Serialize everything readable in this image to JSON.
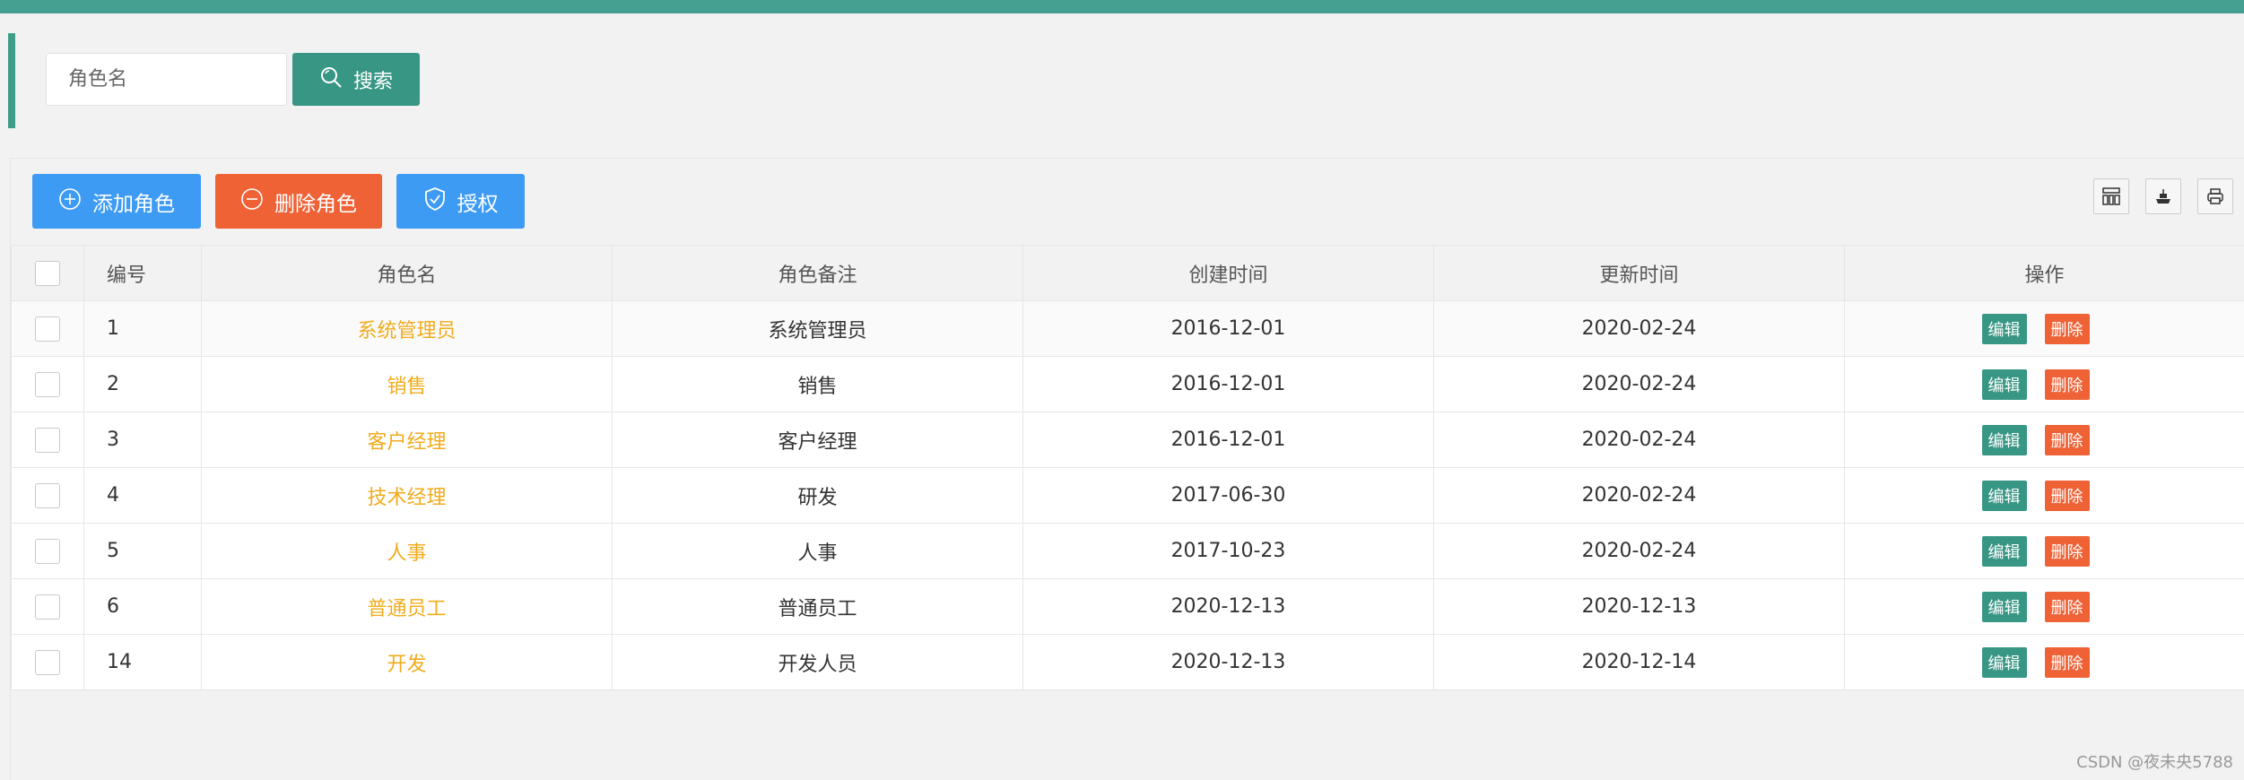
{
  "search": {
    "placeholder": "角色名",
    "button_label": "搜索"
  },
  "toolbar": {
    "add_label": "添加角色",
    "delete_label": "删除角色",
    "auth_label": "授权"
  },
  "table": {
    "headers": {
      "id": "编号",
      "name": "角色名",
      "remark": "角色备注",
      "created": "创建时间",
      "updated": "更新时间",
      "ops": "操作"
    },
    "edit_label": "编辑",
    "delete_label": "删除",
    "rows": [
      {
        "id": "1",
        "name": "系统管理员",
        "remark": "系统管理员",
        "created": "2016-12-01",
        "updated": "2020-02-24"
      },
      {
        "id": "2",
        "name": "销售",
        "remark": "销售",
        "created": "2016-12-01",
        "updated": "2020-02-24"
      },
      {
        "id": "3",
        "name": "客户经理",
        "remark": "客户经理",
        "created": "2016-12-01",
        "updated": "2020-02-24"
      },
      {
        "id": "4",
        "name": "技术经理",
        "remark": "研发",
        "created": "2017-06-30",
        "updated": "2020-02-24"
      },
      {
        "id": "5",
        "name": "人事",
        "remark": "人事",
        "created": "2017-10-23",
        "updated": "2020-02-24"
      },
      {
        "id": "6",
        "name": "普通员工",
        "remark": "普通员工",
        "created": "2020-12-13",
        "updated": "2020-12-13"
      },
      {
        "id": "14",
        "name": "开发",
        "remark": "开发人员",
        "created": "2020-12-13",
        "updated": "2020-12-14"
      }
    ]
  },
  "watermark": "CSDN @夜未央5788",
  "colors": {
    "accent": "#389784",
    "primary": "#3e9bf4",
    "danger": "#ee6236",
    "role_name": "#f0ac1d"
  }
}
